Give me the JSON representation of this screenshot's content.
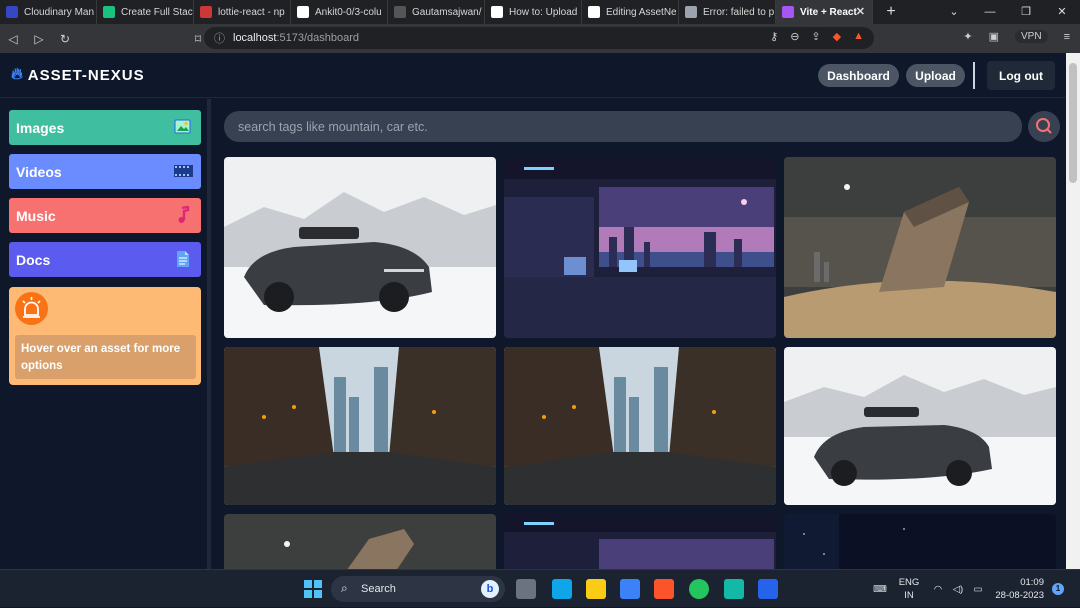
{
  "browser": {
    "tabs": [
      {
        "title": "Cloudinary Man",
        "favicon": "cloudinary-icon",
        "color": "#3448c5"
      },
      {
        "title": "Create Full Stack",
        "favicon": "chatgpt-icon",
        "color": "#19c37d"
      },
      {
        "title": "lottie-react - np",
        "favicon": "npm-icon",
        "color": "#cb3837"
      },
      {
        "title": "Ankit0-0/3-colu",
        "favicon": "github-icon",
        "color": "#ffffff"
      },
      {
        "title": "Gautamsajwan/",
        "favicon": "github-icon",
        "color": "#555555"
      },
      {
        "title": "How to: Upload",
        "favicon": "medium-icon",
        "color": "#ffffff"
      },
      {
        "title": "Editing AssetNe",
        "favicon": "github-icon",
        "color": "#ffffff"
      },
      {
        "title": "Error: failed to p",
        "favicon": "perplexity-icon",
        "color": "#9ca3af"
      },
      {
        "title": "Vite + React",
        "favicon": "vite-icon",
        "color": "#a855f7",
        "active": true
      }
    ],
    "address": {
      "host": "localhost",
      "path": ":5173/dashboard"
    },
    "vpn_label": "VPN"
  },
  "app": {
    "logo_text": "ASSET-NEXUS",
    "nav": {
      "dashboard": "Dashboard",
      "upload": "Upload",
      "logout": "Log out"
    },
    "sidebar": [
      {
        "label": "Images",
        "color": "#3fbf9f",
        "icon": "image-icon"
      },
      {
        "label": "Videos",
        "color": "#6b8cff",
        "icon": "film-icon"
      },
      {
        "label": "Music",
        "color": "#f87171",
        "icon": "music-note-icon"
      },
      {
        "label": "Docs",
        "color": "#5b5bf0",
        "icon": "document-icon"
      }
    ],
    "hint": "Hover over an asset for more options",
    "search_placeholder": "search tags like mountain, car etc.",
    "gallery": [
      {
        "subject": "car-snow"
      },
      {
        "subject": "room-neon"
      },
      {
        "subject": "ruin-desert"
      },
      {
        "subject": "street-city"
      },
      {
        "subject": "street-city"
      },
      {
        "subject": "car-snow"
      },
      {
        "subject": "ruin-desert"
      },
      {
        "subject": "room-neon"
      },
      {
        "subject": "space-dark"
      }
    ]
  },
  "taskbar": {
    "search_label": "Search",
    "lang_top": "ENG",
    "lang_bottom": "IN",
    "time": "01:09",
    "date": "28-08-2023",
    "notifications": "1"
  }
}
